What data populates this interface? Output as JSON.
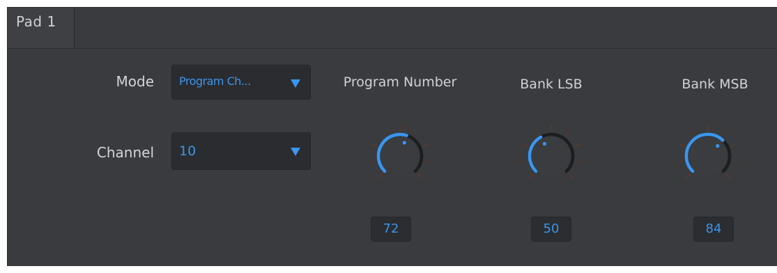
{
  "tab": {
    "label": "Pad 1"
  },
  "fields": {
    "mode": {
      "label": "Mode",
      "value": "Program Ch..."
    },
    "channel": {
      "label": "Channel",
      "value": "10"
    }
  },
  "knobs": [
    {
      "title": "Program Number",
      "value": "72",
      "fraction": 0.567
    },
    {
      "title": "Bank LSB",
      "value": "50",
      "fraction": 0.394
    },
    {
      "title": "Bank MSB",
      "value": "84",
      "fraction": 0.661
    }
  ],
  "colors": {
    "accent": "#3a96f0",
    "panel": "#393b3f",
    "field_bg": "#2a2c30",
    "knob_track": "#1c1d1f",
    "tick_tint": "#5a3a2a"
  },
  "icons": {
    "dropdown": "triangle-down-icon"
  }
}
